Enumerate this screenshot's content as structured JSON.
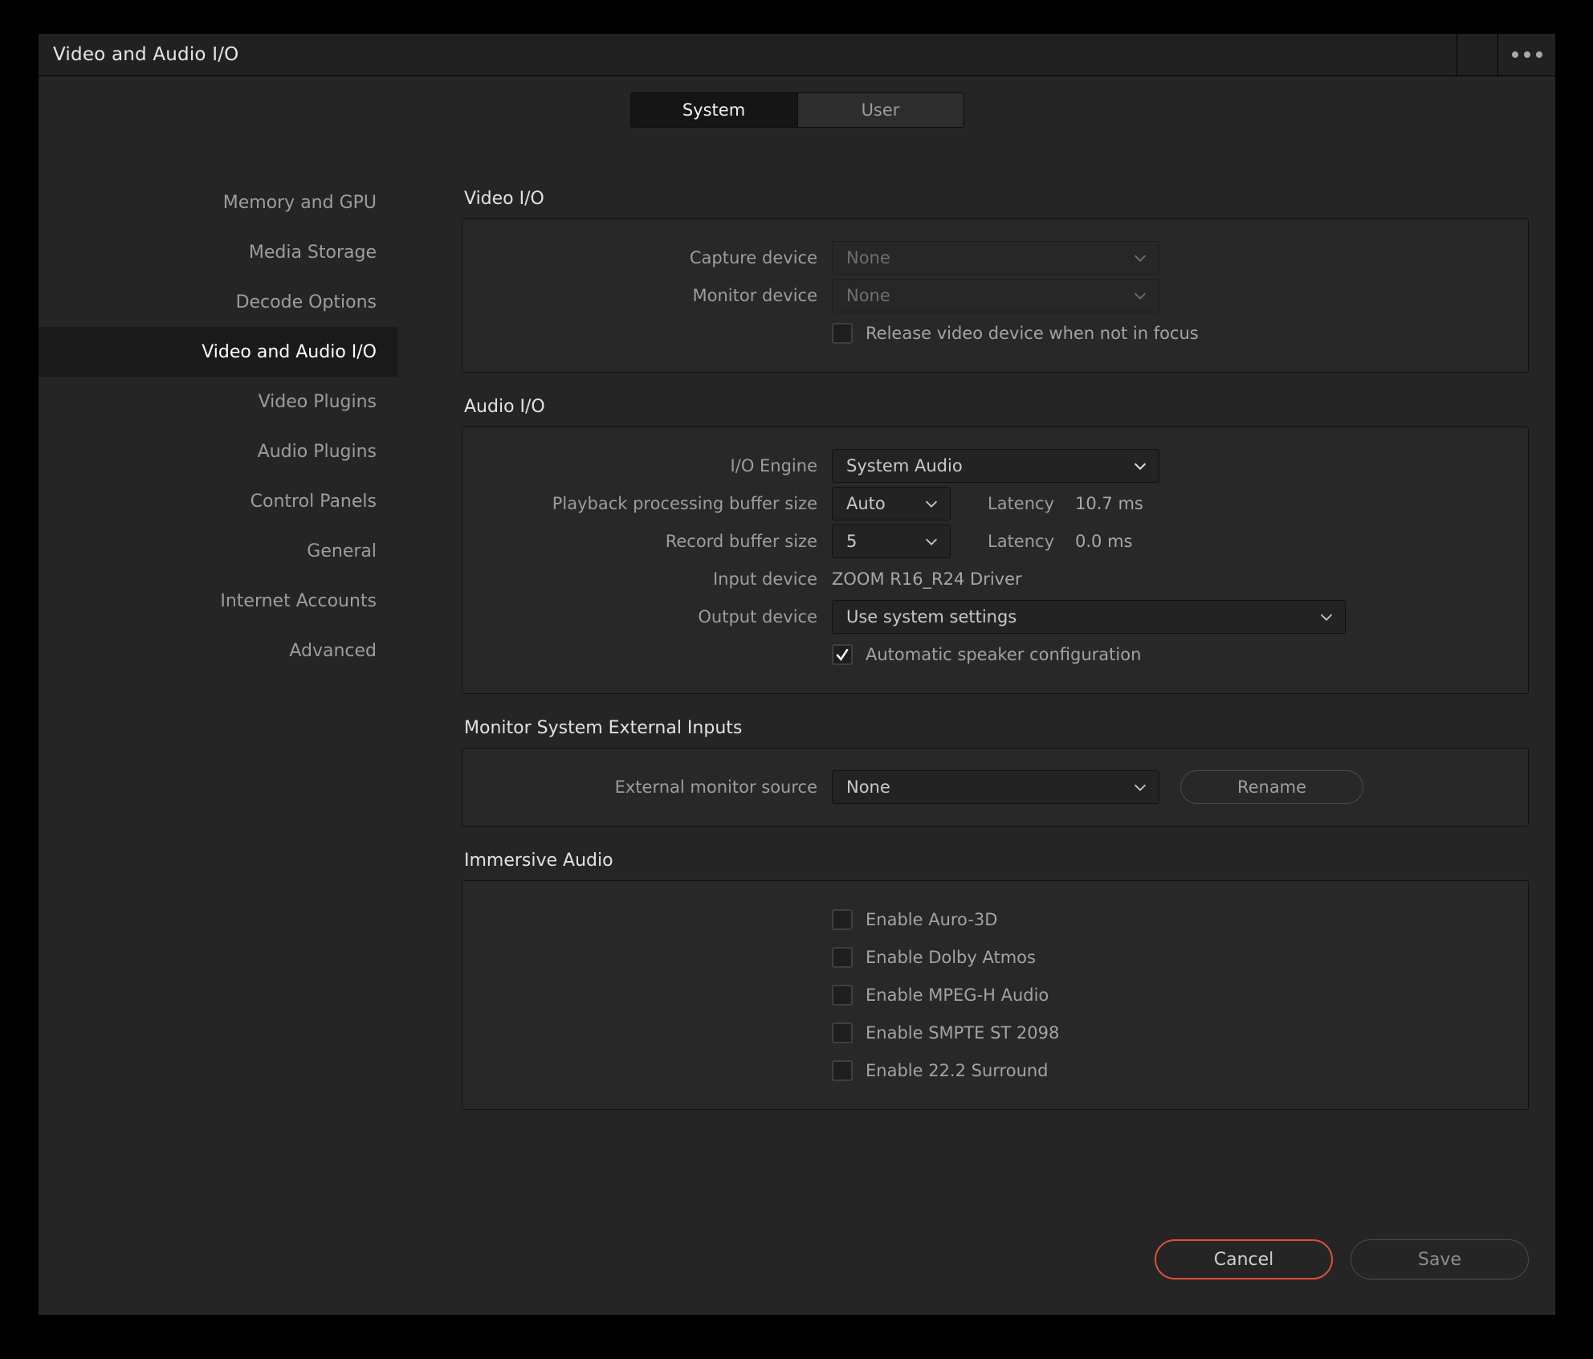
{
  "window": {
    "title": "Video and Audio I/O",
    "menu_icon": "ellipsis-icon"
  },
  "tabs": [
    {
      "label": "System",
      "active": true
    },
    {
      "label": "User",
      "active": false
    }
  ],
  "sidebar": {
    "items": [
      {
        "label": "Memory and GPU"
      },
      {
        "label": "Media Storage"
      },
      {
        "label": "Decode Options"
      },
      {
        "label": "Video and Audio I/O"
      },
      {
        "label": "Video Plugins"
      },
      {
        "label": "Audio Plugins"
      },
      {
        "label": "Control Panels"
      },
      {
        "label": "General"
      },
      {
        "label": "Internet Accounts"
      },
      {
        "label": "Advanced"
      }
    ],
    "active_index": 3
  },
  "video_io": {
    "section_title": "Video I/O",
    "capture_device": {
      "label": "Capture device",
      "value": "None",
      "disabled": true
    },
    "monitor_device": {
      "label": "Monitor device",
      "value": "None",
      "disabled": true
    },
    "release_video": {
      "label": "Release video device when not in focus",
      "checked": false
    }
  },
  "audio_io": {
    "section_title": "Audio I/O",
    "io_engine": {
      "label": "I/O Engine",
      "value": "System Audio"
    },
    "playback_buffer": {
      "label": "Playback processing buffer size",
      "value": "Auto",
      "latency_label": "Latency",
      "latency_value": "10.7 ms"
    },
    "record_buffer": {
      "label": "Record buffer size",
      "value": "5",
      "latency_label": "Latency",
      "latency_value": "0.0 ms"
    },
    "input_device": {
      "label": "Input device",
      "value": "ZOOM R16_R24 Driver"
    },
    "output_device": {
      "label": "Output device",
      "value": "Use system settings"
    },
    "auto_speaker": {
      "label": "Automatic speaker configuration",
      "checked": true
    }
  },
  "monitor_external": {
    "section_title": "Monitor System External Inputs",
    "external_monitor_source": {
      "label": "External monitor source",
      "value": "None"
    },
    "rename_button": "Rename"
  },
  "immersive_audio": {
    "section_title": "Immersive Audio",
    "options": [
      {
        "label": "Enable Auro-3D",
        "checked": false
      },
      {
        "label": "Enable Dolby Atmos",
        "checked": false
      },
      {
        "label": "Enable MPEG-H Audio",
        "checked": false
      },
      {
        "label": "Enable SMPTE ST 2098",
        "checked": false
      },
      {
        "label": "Enable 22.2 Surround",
        "checked": false
      }
    ]
  },
  "footer": {
    "cancel_label": "Cancel",
    "save_label": "Save"
  },
  "colors": {
    "accent_danger": "#e0503a",
    "window_bg": "#252525",
    "panel_bg": "#282828",
    "titlebar_bg": "#212121",
    "active_item_bg": "#1a1a1a"
  }
}
